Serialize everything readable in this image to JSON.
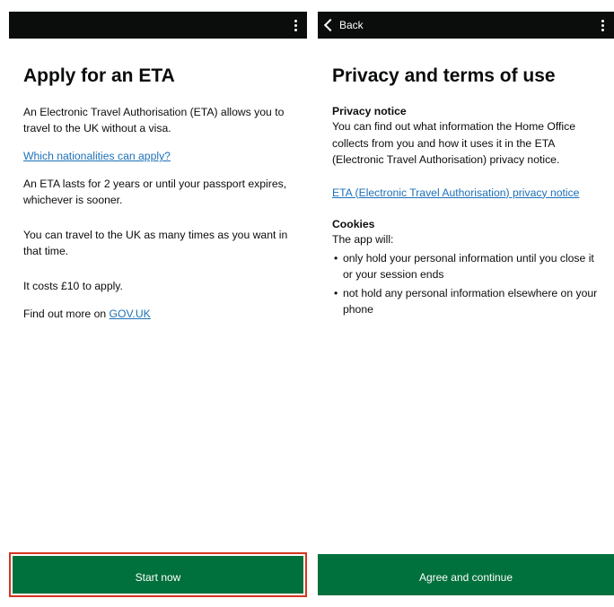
{
  "left_screen": {
    "title": "Apply for an ETA",
    "intro": "An Electronic Travel Authorisation (ETA) allows you to travel to the UK without a visa.",
    "nationalities_link": "Which nationalities can apply?",
    "duration_text": "An ETA lasts for 2 years or until your passport expires, whichever is sooner.",
    "travel_text": "You can travel to the UK as many times as you want in that time.",
    "cost_text": "It costs £10 to apply.",
    "find_out_prefix": "Find out more on ",
    "govuk_link": "GOV.UK",
    "button_label": "Start now"
  },
  "right_screen": {
    "back_label": "Back",
    "title": "Privacy and terms of use",
    "privacy_heading": "Privacy notice",
    "privacy_body": "You can find out what information the Home Office collects from you and how it uses it in the ETA (Electronic Travel Authorisation) privacy notice.",
    "privacy_link": "ETA (Electronic Travel Authorisation) privacy notice",
    "cookies_heading": "Cookies",
    "cookies_intro": "The app will:",
    "cookies_bullets": [
      "only hold your personal information until you close it or your session ends",
      "not hold any personal information elsewhere on your phone"
    ],
    "button_label": "Agree and continue"
  },
  "colors": {
    "top_bar": "#0b0c0c",
    "link": "#1d70b8",
    "button": "#00703c",
    "focus_outline": "#d4351c"
  },
  "icons": {
    "menu": "more-vertical-icon",
    "back": "chevron-left-icon"
  }
}
